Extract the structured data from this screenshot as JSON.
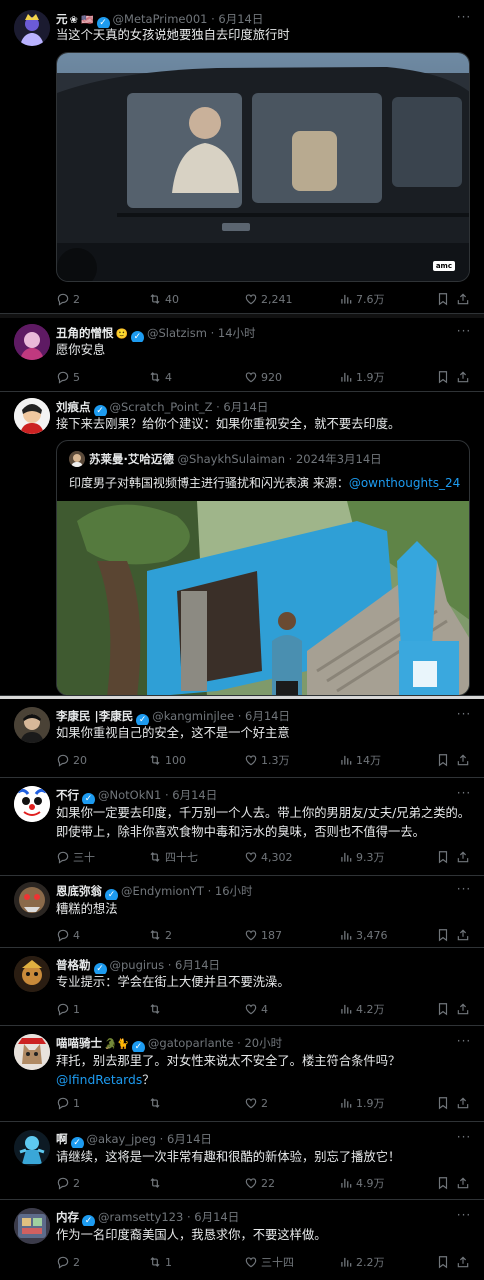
{
  "icons": {
    "reply": "reply-icon",
    "retweet": "retweet-icon",
    "like": "like-icon",
    "views": "views-icon",
    "bookmark": "bookmark-icon",
    "share": "share-icon",
    "more": "more-icon"
  },
  "colors": {
    "background": "#000000",
    "text": "#e7e9ea",
    "muted": "#71767b",
    "accent": "#1d9bf0",
    "divider": "#2f3336"
  },
  "tweets": [
    {
      "name": "元",
      "handle": "@MetaPrime001",
      "time": "· 6月14日",
      "text": "当这个天真的女孩说她要独自去印度旅行时",
      "media_badge": "amc",
      "stats": {
        "reply": "2",
        "retweet": "40",
        "like": "2,241",
        "views": "7.6万"
      }
    },
    {
      "name": "丑角的憎恨",
      "handle": "@Slatzism",
      "time": "· 14小时",
      "text": "愿你安息",
      "stats": {
        "reply": "5",
        "retweet": "4",
        "like": "920",
        "views": "1.9万"
      }
    },
    {
      "name": "刘痕点",
      "handle": "@Scratch_Point_Z",
      "time": "· 6月14日",
      "text": "接下来去刚果？给你个建议：如果你重视安全，就不要去印度。",
      "quote": {
        "name": "苏莱曼·艾哈迈德",
        "handle": "@ShaykhSulaiman",
        "time": "· 2024年3月14日",
        "text_pre": "印度男子对韩国视频博主进行骚扰和闪光表演 来源：",
        "text_link": "@ownthoughts_24"
      }
    },
    {
      "name": "李康民 |李康民",
      "handle": "@kangminjlee",
      "time": "· 6月14日",
      "text": "如果你重视自己的安全，这不是一个好主意",
      "stats": {
        "reply": "20",
        "retweet": "100",
        "like": "1.3万",
        "views": "14万"
      }
    },
    {
      "name": "不行",
      "handle": "@NotOkN1",
      "time": "· 6月14日",
      "text": "如果你一定要去印度，千万别一个人去。带上你的男朋友/丈夫/兄弟之类的。即使带上，除非你喜欢食物中毒和污水的臭味，否则也不值得一去。",
      "stats": {
        "reply": "三十",
        "retweet": "四十七",
        "like": "4,302",
        "views": "9.3万"
      }
    },
    {
      "name": "恩底弥翁",
      "handle": "@EndymionYT",
      "time": "· 16小时",
      "text": "糟糕的想法",
      "stats": {
        "reply": "4",
        "retweet": "2",
        "like": "187",
        "views": "3,476"
      }
    },
    {
      "name": "普格勒",
      "handle": "@pugirus",
      "time": "· 6月14日",
      "text": "专业提示：学会在街上大便并且不要洗澡。",
      "stats": {
        "reply": "1",
        "retweet": "",
        "like": "4",
        "views": "4.2万"
      }
    },
    {
      "name": "喵喵骑士",
      "handle": "@gatoparlante",
      "time": "· 20小时",
      "text_pre": "拜托，别去那里了。对女性来说太不安全了。楼主符合条件吗？",
      "text_link": "@IfindRetards",
      "text_post": "？",
      "stats": {
        "reply": "1",
        "retweet": "",
        "like": "2",
        "views": "1.9万"
      }
    },
    {
      "name": "啊",
      "handle": "@akay_jpeg",
      "time": "· 6月14日",
      "text": "请继续，这将是一次非常有趣和很酷的新体验，别忘了播放它！",
      "stats": {
        "reply": "2",
        "retweet": "",
        "like": "22",
        "views": "4.9万"
      }
    },
    {
      "name": "内存",
      "handle": "@ramsetty123",
      "time": "· 6月14日",
      "text": "作为一名印度裔美国人，我恳求你，不要这样做。",
      "stats": {
        "reply": "2",
        "retweet": "1",
        "like": "三十四",
        "views": "2.2万"
      }
    }
  ]
}
